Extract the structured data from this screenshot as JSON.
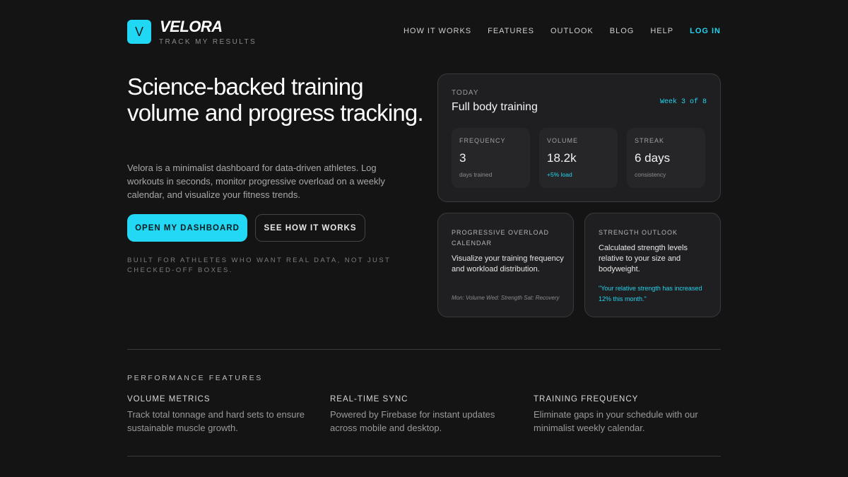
{
  "brand": {
    "logo_letter": "V",
    "name": "VELORA",
    "tagline": "TRACK MY RESULTS",
    "accent_color": "#22d3ee"
  },
  "nav": {
    "items": [
      "HOW IT WORKS",
      "FEATURES",
      "OUTLOOK",
      "BLOG",
      "HELP"
    ],
    "login": "LOG IN"
  },
  "hero": {
    "title": "Science-backed training volume and progress tracking.",
    "description": "Velora is a minimalist dashboard for data-driven athletes. Log workouts in seconds, monitor progressive overload on a weekly calendar, and visualize your fitness trends.",
    "primary_button": "OPEN MY DASHBOARD",
    "secondary_button": "SEE HOW IT WORKS",
    "note": "BUILT FOR ATHLETES WHO WANT REAL DATA, NOT JUST CHECKED-OFF BOXES."
  },
  "today_card": {
    "label": "TODAY",
    "title": "Full body training",
    "week": "Week 3 of 8",
    "stats": [
      {
        "label": "FREQUENCY",
        "value": "3",
        "sub": "days trained"
      },
      {
        "label": "VOLUME",
        "value": "18.2k",
        "sub": "+5% load"
      },
      {
        "label": "STREAK",
        "value": "6 days",
        "sub": "consistency"
      }
    ]
  },
  "overload_card": {
    "label": "PROGRESSIVE OVERLOAD CALENDAR",
    "text": "Visualize your training frequency and workload distribution.",
    "footer": "Mon: Volume Wed: Strength Sat: Recovery"
  },
  "outlook_card": {
    "label": "STRENGTH OUTLOOK",
    "text": "Calculated strength levels relative to your size and bodyweight.",
    "quote": "\"Your relative strength has increased 12% this month.\""
  },
  "features": {
    "heading": "PERFORMANCE FEATURES",
    "items": [
      {
        "title": "VOLUME METRICS",
        "desc": "Track total tonnage and hard sets to ensure sustainable muscle growth."
      },
      {
        "title": "REAL-TIME SYNC",
        "desc": "Powered by Firebase for instant updates across mobile and desktop."
      },
      {
        "title": "TRAINING FREQUENCY",
        "desc": "Eliminate gaps in your schedule with our minimalist weekly calendar."
      }
    ]
  }
}
